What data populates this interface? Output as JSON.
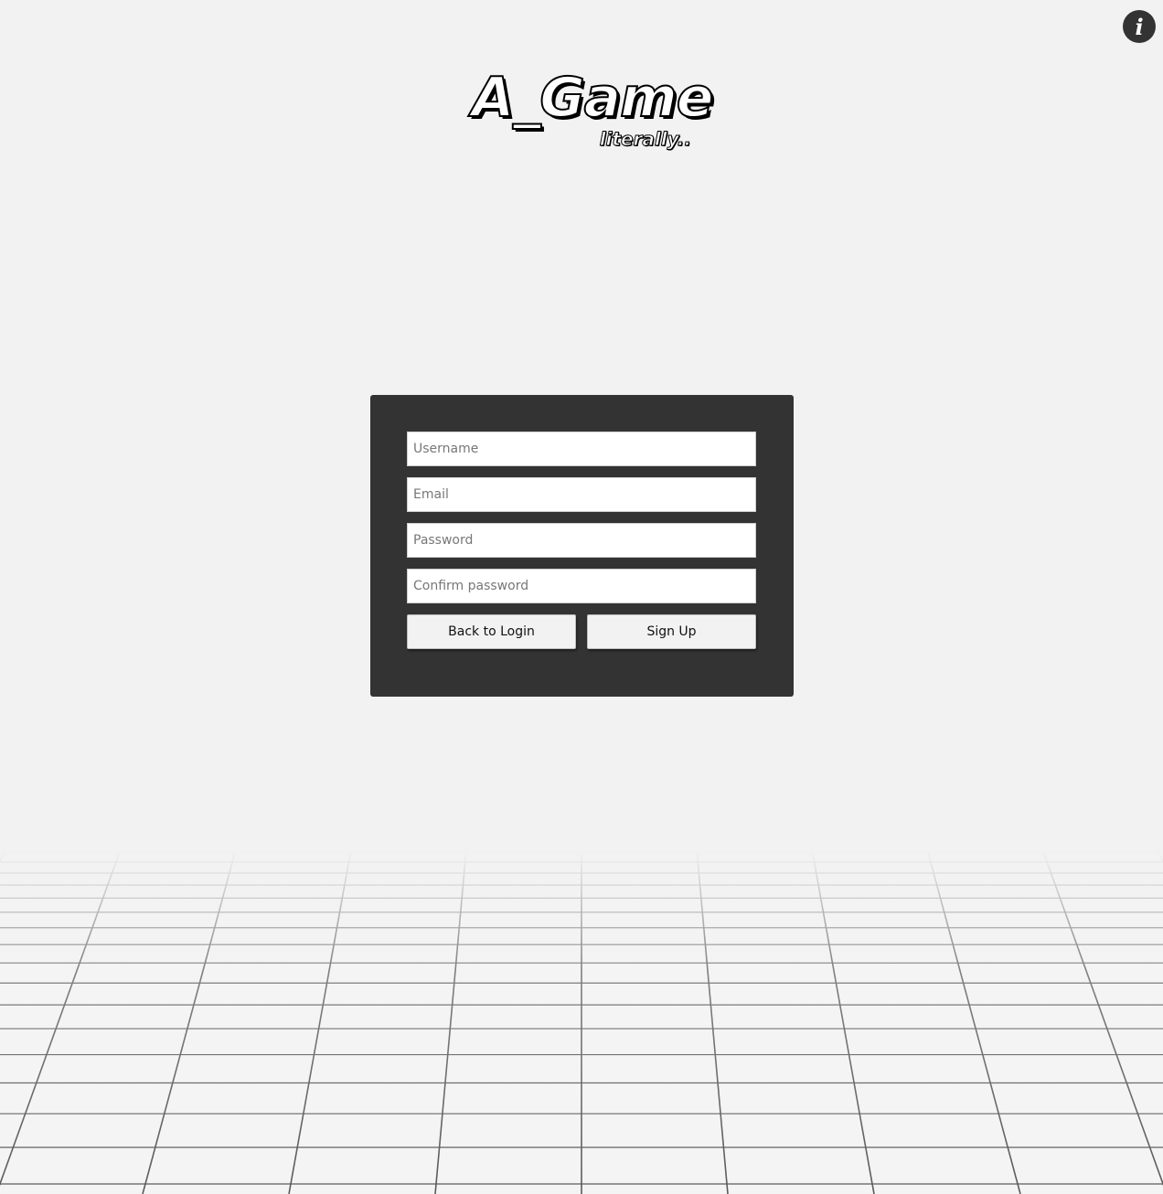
{
  "info_button": {
    "icon": "info-icon",
    "glyph": "i"
  },
  "logo": {
    "title": "A_Game",
    "subtitle": "literally.."
  },
  "signup_form": {
    "username_placeholder": "Username",
    "email_placeholder": "Email",
    "password_placeholder": "Password",
    "confirm_password_placeholder": "Confirm password",
    "back_label": "Back to Login",
    "signup_label": "Sign Up"
  },
  "colors": {
    "background": "#f2f2f2",
    "panel": "#333333",
    "grid_line": "#555555"
  }
}
